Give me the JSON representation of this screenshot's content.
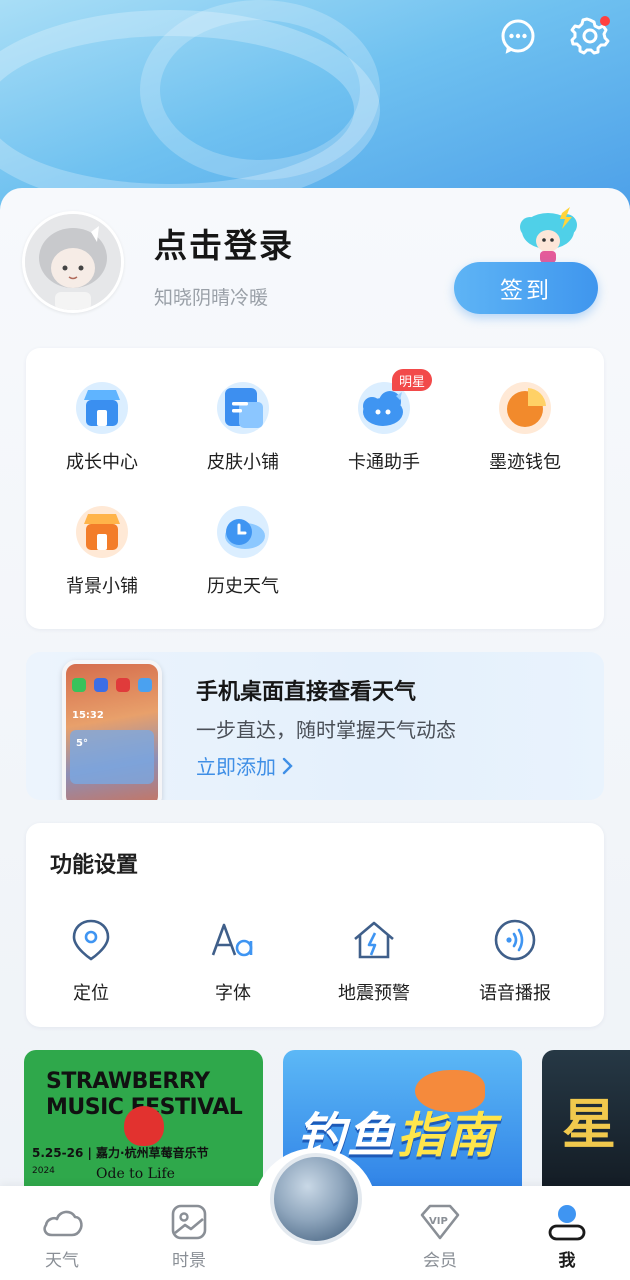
{
  "header": {
    "message_icon": "chat-bubble-icon",
    "settings_icon": "gear-icon",
    "settings_has_notification": true
  },
  "profile": {
    "title": "点击登录",
    "subtitle": "知晓阴晴冷暖",
    "checkin_label": "签到"
  },
  "services": {
    "items": [
      {
        "label": "成长中心",
        "icon": "store-blue-icon"
      },
      {
        "label": "皮肤小铺",
        "icon": "skin-shop-icon"
      },
      {
        "label": "卡通助手",
        "icon": "cartoon-assistant-icon",
        "badge": "明星"
      },
      {
        "label": "墨迹钱包",
        "icon": "wallet-pie-icon"
      },
      {
        "label": "背景小铺",
        "icon": "store-orange-icon"
      },
      {
        "label": "历史天气",
        "icon": "history-weather-icon"
      }
    ]
  },
  "banner": {
    "title": "手机桌面直接查看天气",
    "subtitle": "一步直达，随时掌握天气动态",
    "link": "立即添加",
    "phone_time": "15:32",
    "phone_temp": "5°"
  },
  "settings": {
    "title": "功能设置",
    "items": [
      {
        "label": "定位",
        "icon": "location-pin-icon"
      },
      {
        "label": "字体",
        "icon": "font-aa-icon"
      },
      {
        "label": "地震预警",
        "icon": "earthquake-house-icon"
      },
      {
        "label": "语音播报",
        "icon": "voice-broadcast-icon"
      }
    ]
  },
  "promos": [
    {
      "line1": "STRAWBERRY",
      "line2": "MUSIC FESTIVAL",
      "detail": "5.25-26 | 嘉力·杭州草莓音乐节",
      "year": "2024",
      "slogan": "Ode to Life"
    },
    {
      "text_a": "钓鱼",
      "text_b": "指南"
    },
    {
      "text": "星"
    }
  ],
  "bottom_nav": {
    "items": [
      {
        "label": "天气",
        "icon": "cloud-icon"
      },
      {
        "label": "时景",
        "icon": "image-icon"
      },
      {
        "label": "会员",
        "icon": "vip-diamond-icon"
      },
      {
        "label": "我",
        "icon": "user-icon",
        "active": true
      }
    ]
  },
  "colors": {
    "accent": "#3f96ee",
    "link": "#3f8fe6",
    "badge": "#f24a4a",
    "header_start": "#a9def6",
    "header_end": "#4a9de8"
  }
}
